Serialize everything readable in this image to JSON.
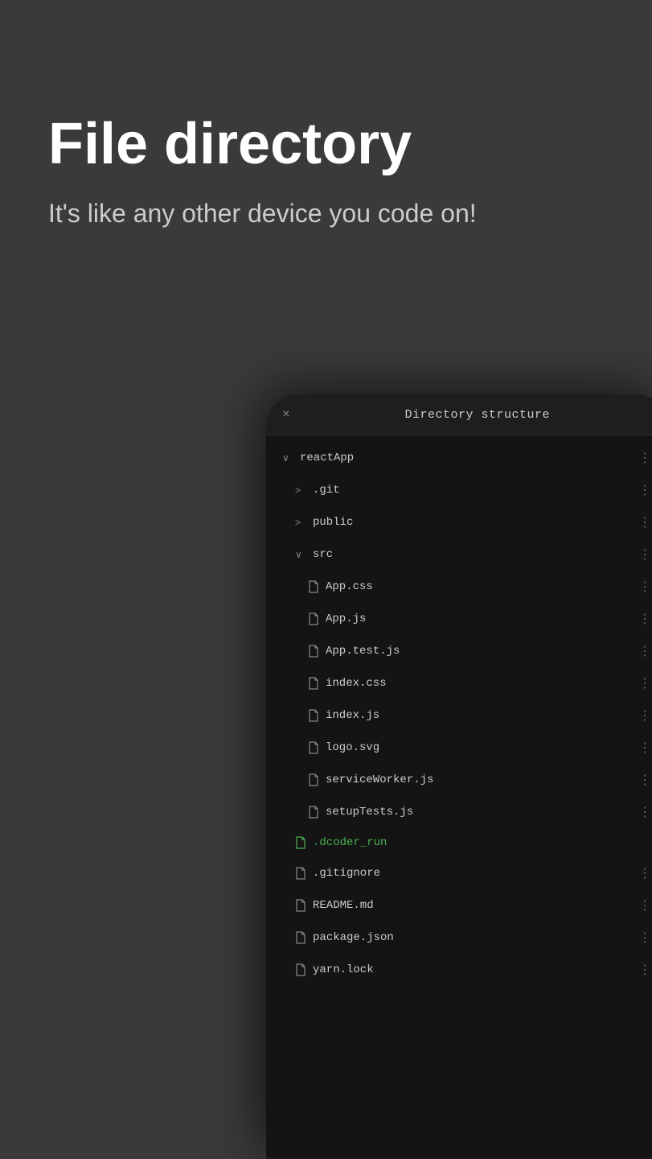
{
  "hero": {
    "title": "File directory",
    "subtitle": "It's like any other device you code on!"
  },
  "panel": {
    "close_label": "×",
    "title": "Directory structure"
  },
  "tree": [
    {
      "id": "reactApp",
      "label": "reactApp",
      "type": "folder",
      "expanded": true,
      "indent": 0,
      "chevron": "∨"
    },
    {
      "id": "git",
      "label": ".git",
      "type": "folder",
      "expanded": false,
      "indent": 1,
      "chevron": ">"
    },
    {
      "id": "public",
      "label": "public",
      "type": "folder",
      "expanded": false,
      "indent": 1,
      "chevron": ">"
    },
    {
      "id": "src",
      "label": "src",
      "type": "folder",
      "expanded": true,
      "indent": 1,
      "chevron": "∨"
    },
    {
      "id": "app-css",
      "label": "App.css",
      "type": "file",
      "indent": 2
    },
    {
      "id": "app-js",
      "label": "App.js",
      "type": "file",
      "indent": 2
    },
    {
      "id": "app-test-js",
      "label": "App.test.js",
      "type": "file",
      "indent": 2
    },
    {
      "id": "index-css",
      "label": "index.css",
      "type": "file",
      "indent": 2
    },
    {
      "id": "index-js",
      "label": "index.js",
      "type": "file",
      "indent": 2
    },
    {
      "id": "logo-svg",
      "label": "logo.svg",
      "type": "file",
      "indent": 2
    },
    {
      "id": "serviceWorker",
      "label": "serviceWorker.js",
      "type": "file",
      "indent": 2
    },
    {
      "id": "setupTests",
      "label": "setupTests.js",
      "type": "file",
      "indent": 2
    },
    {
      "id": "dcoder-run",
      "label": ".dcoder_run",
      "type": "file",
      "indent": 1,
      "green": true
    },
    {
      "id": "gitignore",
      "label": ".gitignore",
      "type": "file",
      "indent": 1
    },
    {
      "id": "readme",
      "label": "README.md",
      "type": "file",
      "indent": 1
    },
    {
      "id": "package-json",
      "label": "package.json",
      "type": "file",
      "indent": 1
    },
    {
      "id": "yarn-lock",
      "label": "yarn.lock",
      "type": "file",
      "indent": 1
    }
  ],
  "icons": {
    "file_icon": "□",
    "folder_chevron_open": "∨",
    "folder_chevron_closed": ">"
  }
}
